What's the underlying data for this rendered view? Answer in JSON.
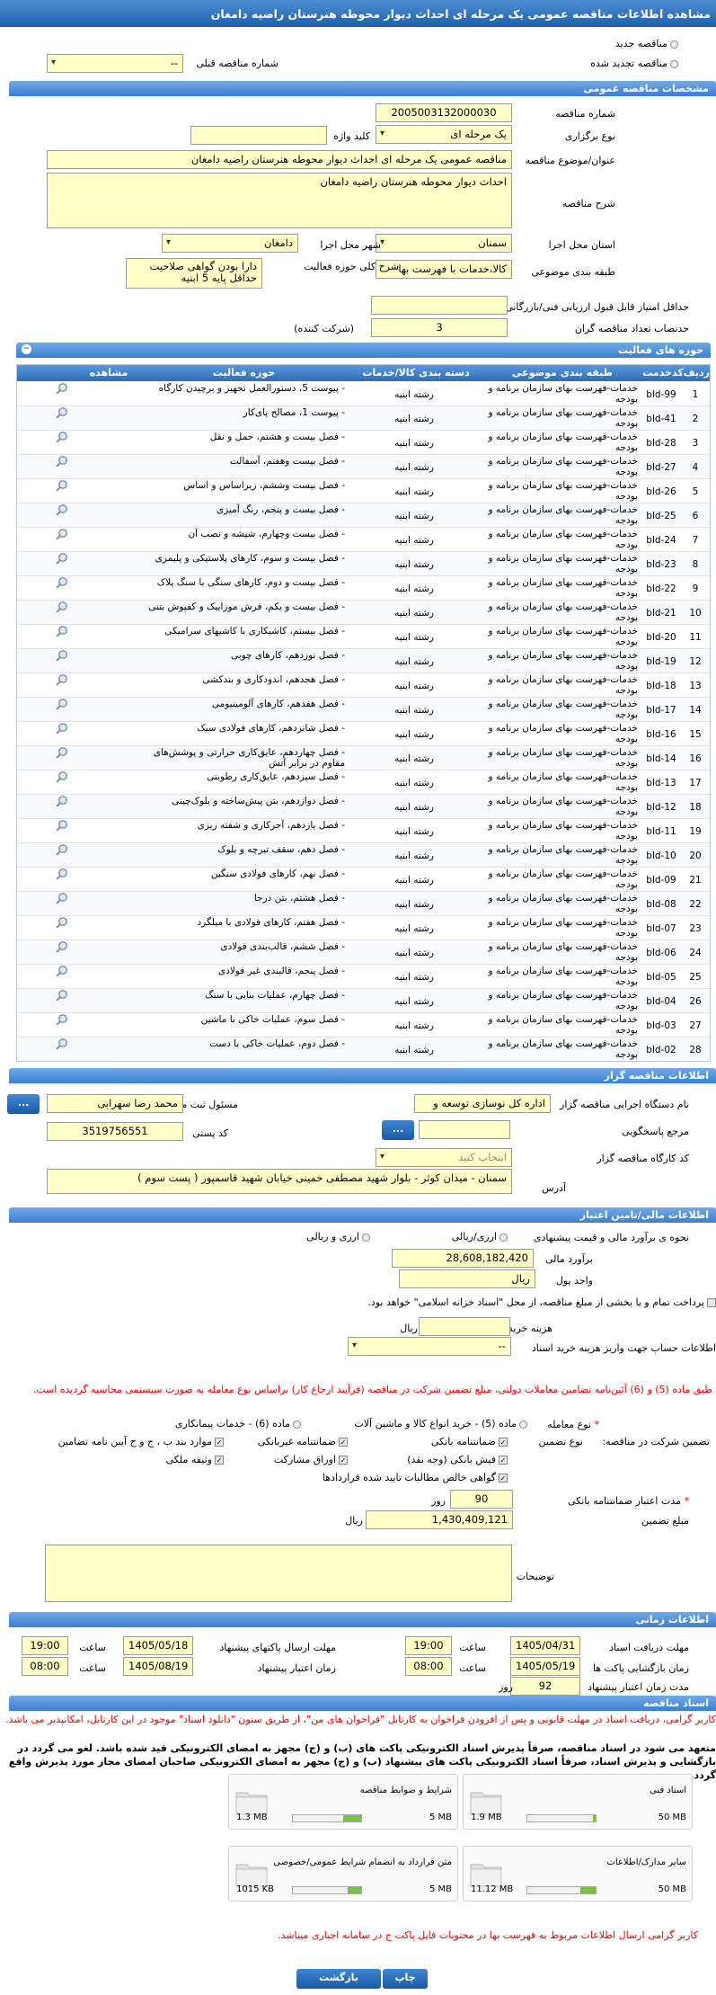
{
  "page_title": "مشاهده اطلاعات مناقصه عمومی یک مرحله ای احداث دیوار محوطه هنرستان راضیه دامغان",
  "top": {
    "new_tender": "مناقصه جدید",
    "renewed_tender": "مناقصه تجدید شده",
    "prev_number_label": "شماره مناقصه قبلی",
    "prev_number_value": "--"
  },
  "general": {
    "section": "مشخصات مناقصه عمومی",
    "number_label": "شماره مناقصه",
    "number_value": "2005003132000030",
    "type_label": "نوع برگزاری",
    "type_value": "یک مرحله ای",
    "keyword_label": "کلید واژه",
    "keyword_value": "",
    "title_label": "عنوان/موضوع مناقصه",
    "title_value": "مناقصه عمومی یک مرحله ای احداث دیوار محوطه هنرستان  راضیه دامغان",
    "desc_label": "شرح مناقصه",
    "desc_value": "احداث دیوار محوطه هنرستان  راضیه دامغان",
    "province_label": "استان محل اجرا",
    "province_value": "سمنان",
    "city_label": "شهر محل اجرا",
    "city_value": "دامغان",
    "category_label": "طبقه بندی موضوعی",
    "category_value": "کالا،خدمات با فهرست بها",
    "scope_label": "شرح کلی حوزه فعالیت",
    "scope_value": "دارا بودن گواهی صلاحیت حداقل پایه 5 ابنیه",
    "min_score_label": "حداقل امتیاز قابل قبول ارزیابی فنی/بازرگانی",
    "min_score_value": "",
    "min_bidders_label": "حدنصاب تعداد مناقصه گران",
    "min_bidders_value": "3",
    "min_bidders_unit": "(شرکت کننده)"
  },
  "activities": {
    "section": "حوزه های فعالیت",
    "headers": {
      "row": "ردیف",
      "code": "کدخدمت",
      "category": "طبقه بندی موضوعی",
      "group": "دسته بندی کالا/خدمات",
      "field": "حوزه فعالیت",
      "view": "مشاهده"
    },
    "rows": [
      {
        "n": "1",
        "code": "bld-99",
        "cat": "خدمات-فهرست بهای سازمان برنامه و بودجه",
        "grp": "رشته ابنیه",
        "field": "- پیوست 5، دستورالعمل تجهیز و برچیدن کارگاه"
      },
      {
        "n": "2",
        "code": "bld-41",
        "cat": "خدمات-فهرست بهای سازمان برنامه و بودجه",
        "grp": "رشته ابنیه",
        "field": "- پیوست 1، مصالح پای‌کار"
      },
      {
        "n": "3",
        "code": "bld-28",
        "cat": "خدمات-فهرست بهای سازمان برنامه و بودجه",
        "grp": "رشته ابنیه",
        "field": "- فصل بیست و هشتم، حمل و نقل"
      },
      {
        "n": "4",
        "code": "bld-27",
        "cat": "خدمات-فهرست بهای سازمان برنامه و بودجه",
        "grp": "رشته ابنیه",
        "field": "- فصل بیست وهفتم، آسفالت"
      },
      {
        "n": "5",
        "code": "bld-26",
        "cat": "خدمات-فهرست بهای سازمان برنامه و بودجه",
        "grp": "رشته ابنیه",
        "field": "- فصل بیست وششم، زیراساس و اساس"
      },
      {
        "n": "6",
        "code": "bld-25",
        "cat": "خدمات-فهرست بهای سازمان برنامه و بودجه",
        "grp": "رشته ابنیه",
        "field": "- فصل بیست و پنجم، رنگ آمیزی"
      },
      {
        "n": "7",
        "code": "bld-24",
        "cat": "خدمات-فهرست بهای سازمان برنامه و بودجه",
        "grp": "رشته ابنیه",
        "field": "- فصل بیست وچهارم، شیشه و نصب آن"
      },
      {
        "n": "8",
        "code": "bld-23",
        "cat": "خدمات-فهرست بهای سازمان برنامه و بودجه",
        "grp": "رشته ابنیه",
        "field": "- فصل بیست و سوم، کارهای پلاستیکی و پلیمری"
      },
      {
        "n": "9",
        "code": "bld-22",
        "cat": "خدمات-فهرست بهای سازمان برنامه و بودجه",
        "grp": "رشته ابنیه",
        "field": "- فصل بیست و دوم، کارهای سنگی با سنگ پلاک"
      },
      {
        "n": "10",
        "code": "bld-21",
        "cat": "خدمات-فهرست بهای سازمان برنامه و بودجه",
        "grp": "رشته ابنیه",
        "field": "- فصل بیست و یکم، فرش موزاییک و کفپوش بتنی"
      },
      {
        "n": "11",
        "code": "bld-20",
        "cat": "خدمات-فهرست بهای سازمان برنامه و بودجه",
        "grp": "رشته ابنیه",
        "field": "- فصل بیستم، کاشیکاری با کاشیهای سرامیکی"
      },
      {
        "n": "12",
        "code": "bld-19",
        "cat": "خدمات-فهرست بهای سازمان برنامه و بودجه",
        "grp": "رشته ابنیه",
        "field": "- فصل نوزدهم، کارهای چوبی"
      },
      {
        "n": "13",
        "code": "bld-18",
        "cat": "خدمات-فهرست بهای سازمان برنامه و بودجه",
        "grp": "رشته ابنیه",
        "field": "- فصل هجدهم، اندودکاری و بندکشی"
      },
      {
        "n": "14",
        "code": "bld-17",
        "cat": "خدمات-فهرست بهای سازمان برنامه و بودجه",
        "grp": "رشته ابنیه",
        "field": "- فصل هفدهم، کارهای آلومینیومی"
      },
      {
        "n": "15",
        "code": "bld-16",
        "cat": "خدمات-فهرست بهای سازمان برنامه و بودجه",
        "grp": "رشته ابنیه",
        "field": "- فصل شانزدهم، کارهای فولادی سبک"
      },
      {
        "n": "16",
        "code": "bld-14",
        "cat": "خدمات-فهرست بهای سازمان برنامه و بودجه",
        "grp": "رشته ابنیه",
        "field": "- فصل چهاردهم، عایق‌کاری حرارتی و پوشش‌های مقاوم در برابر آتش"
      },
      {
        "n": "17",
        "code": "bld-13",
        "cat": "خدمات-فهرست بهای سازمان برنامه و بودجه",
        "grp": "رشته ابنیه",
        "field": "- فصل سیزدهم، عایق‌کاری رطوبتی"
      },
      {
        "n": "18",
        "code": "bld-12",
        "cat": "خدمات-فهرست بهای سازمان برنامه و بودجه",
        "grp": "رشته ابنیه",
        "field": "- فصل دوازدهم، بتن پیش‌ساخته و بلوک‌چینی"
      },
      {
        "n": "19",
        "code": "bld-11",
        "cat": "خدمات-فهرست بهای سازمان برنامه و بودجه",
        "grp": "رشته ابنیه",
        "field": "- فصل یازدهم، آجرکاری و شفته ریزی"
      },
      {
        "n": "20",
        "code": "bld-10",
        "cat": "خدمات-فهرست بهای سازمان برنامه و بودجه",
        "grp": "رشته ابنیه",
        "field": "- فصل دهم، سقف تیرچه و بلوک"
      },
      {
        "n": "21",
        "code": "bld-09",
        "cat": "خدمات-فهرست بهای سازمان برنامه و بودجه",
        "grp": "رشته ابنیه",
        "field": "- فصل نهم، کارهای فولادی سنگین"
      },
      {
        "n": "22",
        "code": "bld-08",
        "cat": "خدمات-فهرست بهای سازمان برنامه و بودجه",
        "grp": "رشته ابنیه",
        "field": "- فصل هشتم، بتن درجا"
      },
      {
        "n": "23",
        "code": "bld-07",
        "cat": "خدمات-فهرست بهای سازمان برنامه و بودجه",
        "grp": "رشته ابنیه",
        "field": "- فصل هفتم، کارهای فولادی با میلگرد"
      },
      {
        "n": "24",
        "code": "bld-06",
        "cat": "خدمات-فهرست بهای سازمان برنامه و بودجه",
        "grp": "رشته ابنیه",
        "field": "- فصل ششم، قالب‌بندی فولادی"
      },
      {
        "n": "25",
        "code": "bld-05",
        "cat": "خدمات-فهرست بهای سازمان برنامه و بودجه",
        "grp": "رشته ابنیه",
        "field": "- فصل پنجم، قالبندی غیر فولادی"
      },
      {
        "n": "26",
        "code": "bld-04",
        "cat": "خدمات-فهرست بهای سازمان برنامه و بودجه",
        "grp": "رشته ابنیه",
        "field": "- فصل چهارم، عملیات بنایی با سنگ"
      },
      {
        "n": "27",
        "code": "bld-03",
        "cat": "خدمات-فهرست بهای سازمان برنامه و بودجه",
        "grp": "رشته ابنیه",
        "field": "- فصل سوم، عملیات خاکی با ماشین"
      },
      {
        "n": "28",
        "code": "bld-02",
        "cat": "خدمات-فهرست بهای سازمان برنامه و بودجه",
        "grp": "رشته ابنیه",
        "field": "- فصل دوم، عملیات خاکی با دست"
      }
    ]
  },
  "organizer": {
    "section": "اطلاعات مناقصه گزار",
    "name_label": "نام دستگاه اجرایی مناقصه گزار",
    "name_value": "اداره کل نوسازی   توسعه و",
    "resp_label": "مسئول ثبت مناقصه",
    "resp_value": "محمد رضا   سهرابی",
    "ref_label": "مرجع پاسخگویی",
    "ref_value": "",
    "postal_label": "کد پستی",
    "postal_value": "3519756551",
    "workshop_label": "کد کارگاه مناقصه گزار",
    "workshop_value": "انتخاب کنید",
    "address_label": "آدرس",
    "address_value": "سمنان - میدان کوثر - بلوار شهید مصطفی خمینی خیابان شهید قاسمپور ( پست سوم )",
    "more": "..."
  },
  "financial": {
    "section": "اطلاعات مالی/تامین اعتبار",
    "estimate_label": "نحوه ی برآورد مالی و قیمت پیشنهادی",
    "opt_rial": "ارزی/ریالی",
    "opt_fx": "ارزی و ریالی",
    "estimate_amount_label": "برآورد مالی",
    "estimate_amount_value": "28,608,182,420",
    "currency_label": "واحد پول",
    "currency_value": "ریال",
    "treasury_text": "پرداخت تمام و یا بخشی از مبلغ مناقصه، از محل \"اسناد خزانه اسلامی\" خواهد بود.",
    "doc_cost_label": "هزینه خرید اسناد",
    "doc_cost_unit": "ریال",
    "account_label": "اطلاعات حساب جهت واریز هزینه خرید اسناد",
    "account_value": "--",
    "note": "طبق ماده (5) و (6) آئین‌نامه تضامین معاملات دولتی، مبلغ تضمین شرکت در مناقصه (فرآیند ارجاع کار) براساس نوع معامله به صورت سیستمی محاسبه گردیده است.",
    "deal_type_label": "نوع معامله",
    "deal_opt1": "ماده (5) - خرید انواع کالا و ماشین آلات",
    "deal_opt2": "ماده (6) - خدمات پیمانکاری",
    "guarantee_label": "تضمین شرکت در مناقصه:",
    "guarantee_type_label": "نوع تضمین",
    "g1": "ضمانتنامه بانکی",
    "g2": "ضمانتنامه غیربانکی",
    "g3": "موارد بند ب ، ج و ح آیین نامه تضامین",
    "g4": "فیش بانکی (وجه نقد)",
    "g5": "اوراق مشارکت",
    "g6": "وثیقه ملکی",
    "g7": "گواهی خالص مطالبات تایید شده قراردادها",
    "validity_label": "مدت اعتبار ضمانتنامه بانکی",
    "validity_value": "90",
    "validity_unit": "روز",
    "guarantee_amount_label": "مبلغ تضمین",
    "guarantee_amount_value": "1,430,409,121",
    "guarantee_amount_unit": "ریال",
    "desc_label": "توضیحات",
    "desc_value": ""
  },
  "timing": {
    "section": "اطلاعات زمانی",
    "receive_label": "مهلت دریافت اسناد",
    "receive_date": "1405/04/31",
    "receive_time": "19:00",
    "send_label": "مهلت ارسال پاکتهای پیشنهاد",
    "send_date": "1405/05/18",
    "send_time": "19:00",
    "open_label": "زمان بازگشایی پاکت ها",
    "open_date": "1405/05/19",
    "open_time": "08:00",
    "valid_label": "زمان اعتبار پیشنهاد",
    "valid_date": "1405/08/19",
    "valid_time": "08:00",
    "duration_label": "مدت زمان اعتبار پیشنهاد",
    "duration_value": "92",
    "duration_unit": "روز",
    "time_label": "ساعت"
  },
  "documents": {
    "section": "اسناد مناقصه",
    "note1": "کاربر گرامی، دریافت اسناد در مهلت قانونی و پس از افزودن فراخوان به کارتابل \"فراخوان های من\"، از طریق ستون \"دانلود اسناد\" موجود در این کارتابل، امکانپذیر می باشد.",
    "note2": "متعهد می شود در اسناد مناقصه، صرفاً پذیرش اسناد الکترونیکی پاکت های (ب) و (ج) مجهز به امضای الکترونیکی قید شده باشد. لغو می گردد در بازگشایی و پذیرش اسناد، صرفاً اسناد الکترونیکی پاکت های پیشنهاد (ب) و (ج) مجهز به امضای الکترونیکی صاحبان امضای مجاز مورد پذیرش واقع گردد.",
    "files": [
      {
        "name": "شرایط و ضوابط مناقصه",
        "size": "1.3 MB",
        "max": "5 MB",
        "pct": 26
      },
      {
        "name": "اسناد فنی",
        "size": "1.9 MB",
        "max": "50 MB",
        "pct": 4
      },
      {
        "name": "متن قرارداد به انضمام شرایط عمومی/خصوصی",
        "size": "1015 KB",
        "max": "5 MB",
        "pct": 20
      },
      {
        "name": "سایر مدارک/اطلاعات",
        "size": "11.12 MB",
        "max": "50 MB",
        "pct": 22
      }
    ],
    "note3": "کاربر گرامی ارسال اطلاعات مربوط به فهرست بها در محتویات فایل پاکت ج در سامانه اجباری میباشد."
  },
  "footer": {
    "print": "چاپ",
    "back": "بازگشت"
  }
}
